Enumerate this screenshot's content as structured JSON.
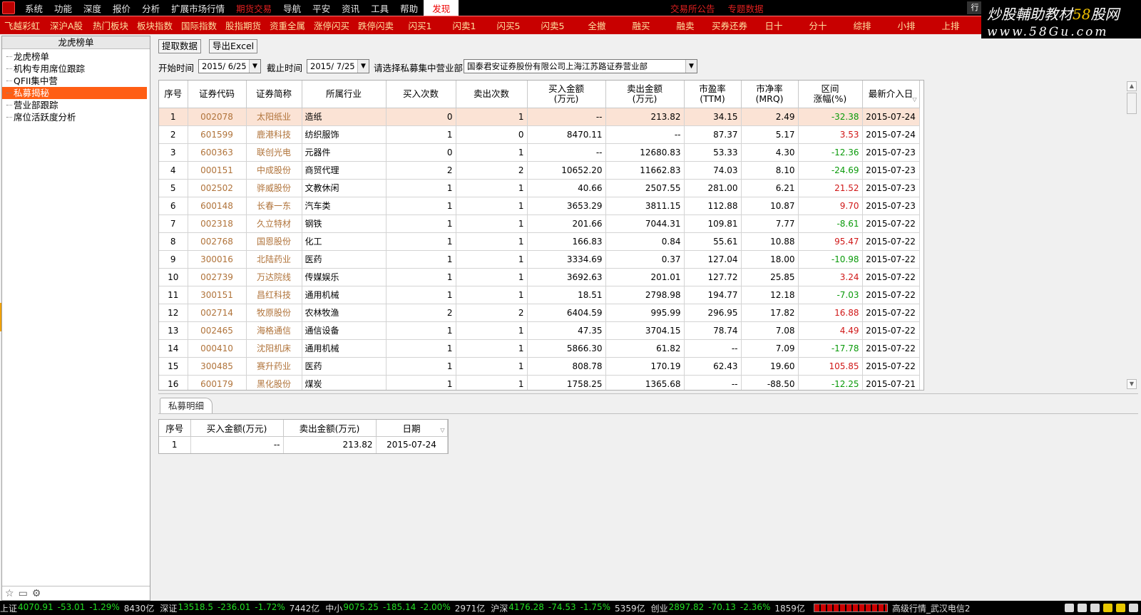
{
  "menu": {
    "items": [
      {
        "label": "系统",
        "style": "normal"
      },
      {
        "label": "功能",
        "style": "normal"
      },
      {
        "label": "深度",
        "style": "normal"
      },
      {
        "label": "报价",
        "style": "normal"
      },
      {
        "label": "分析",
        "style": "normal"
      },
      {
        "label": "扩展市场行情",
        "style": "normal"
      },
      {
        "label": "期货交易",
        "style": "red"
      },
      {
        "label": "导航",
        "style": "normal"
      },
      {
        "label": "平安",
        "style": "normal"
      },
      {
        "label": "资讯",
        "style": "normal"
      },
      {
        "label": "工具",
        "style": "normal"
      },
      {
        "label": "帮助",
        "style": "normal"
      },
      {
        "label": "发现",
        "style": "active"
      }
    ],
    "promo": [
      "交易所公告",
      "专题数据"
    ],
    "right_tab": "行"
  },
  "watermark": {
    "line1_a": "炒股輔助教材",
    "line1_b": "58",
    "line1_c": "股网",
    "line2": "www.58Gu.com"
  },
  "funcbar": [
    "飞越彩虹",
    "深沪A股",
    "热门板块",
    "板块指数",
    "国际指数",
    "股指期货",
    "资重全属",
    "涨停闪买",
    "跌停闪卖",
    "闪买1",
    "闪卖1",
    "闪买5",
    "闪卖5",
    "全撤",
    "融买",
    "融卖",
    "买券还券",
    "日十",
    "分十",
    "综排",
    "小排",
    "上排"
  ],
  "left": {
    "title": "龙虎榜单",
    "items": [
      {
        "label": "龙虎榜单",
        "selected": false
      },
      {
        "label": "机构专用席位跟踪",
        "selected": false
      },
      {
        "label": "QFII集中营",
        "selected": false
      },
      {
        "label": "私募揭秘",
        "selected": true
      },
      {
        "label": "营业部跟踪",
        "selected": false
      },
      {
        "label": "席位活跃度分析",
        "selected": false
      }
    ]
  },
  "toolbar": {
    "fetch_label": "提取数据",
    "export_label": "导出Excel"
  },
  "filter": {
    "start_label": "开始时间",
    "start_value": "2015/ 6/25",
    "end_label": "截止时间",
    "end_value": "2015/ 7/25",
    "dept_label": "请选择私募集中营业部",
    "dept_value": "国泰君安证券股份有限公司上海江苏路证券营业部"
  },
  "table": {
    "headers": [
      "序号",
      "证券代码",
      "证券简称",
      "所属行业",
      "买入次数",
      "卖出次数",
      "买入金额\n(万元)",
      "卖出金额\n(万元)",
      "市盈率\n(TTM)",
      "市净率\n(MRQ)",
      "区间\n涨幅(%)",
      "最新介入日"
    ],
    "rows": [
      {
        "no": "1",
        "code": "002078",
        "name": "太阳纸业",
        "industry": "造纸",
        "buy_n": "0",
        "sell_n": "1",
        "buy_amt": "--",
        "sell_amt": "213.82",
        "pe": "34.15",
        "pb": "2.49",
        "chg": "-32.38",
        "date": "2015-07-24"
      },
      {
        "no": "2",
        "code": "601599",
        "name": "鹿港科技",
        "industry": "纺织服饰",
        "buy_n": "1",
        "sell_n": "0",
        "buy_amt": "8470.11",
        "sell_amt": "--",
        "pe": "87.37",
        "pb": "5.17",
        "chg": "3.53",
        "date": "2015-07-24"
      },
      {
        "no": "3",
        "code": "600363",
        "name": "联创光电",
        "industry": "元器件",
        "buy_n": "0",
        "sell_n": "1",
        "buy_amt": "--",
        "sell_amt": "12680.83",
        "pe": "53.33",
        "pb": "4.30",
        "chg": "-12.36",
        "date": "2015-07-23"
      },
      {
        "no": "4",
        "code": "000151",
        "name": "中成股份",
        "industry": "商贸代理",
        "buy_n": "2",
        "sell_n": "2",
        "buy_amt": "10652.20",
        "sell_amt": "11662.83",
        "pe": "74.03",
        "pb": "8.10",
        "chg": "-24.69",
        "date": "2015-07-23"
      },
      {
        "no": "5",
        "code": "002502",
        "name": "骅威股份",
        "industry": "文教休闲",
        "buy_n": "1",
        "sell_n": "1",
        "buy_amt": "40.66",
        "sell_amt": "2507.55",
        "pe": "281.00",
        "pb": "6.21",
        "chg": "21.52",
        "date": "2015-07-23"
      },
      {
        "no": "6",
        "code": "600148",
        "name": "长春一东",
        "industry": "汽车类",
        "buy_n": "1",
        "sell_n": "1",
        "buy_amt": "3653.29",
        "sell_amt": "3811.15",
        "pe": "112.88",
        "pb": "10.87",
        "chg": "9.70",
        "date": "2015-07-23"
      },
      {
        "no": "7",
        "code": "002318",
        "name": "久立特材",
        "industry": "钢铁",
        "buy_n": "1",
        "sell_n": "1",
        "buy_amt": "201.66",
        "sell_amt": "7044.31",
        "pe": "109.81",
        "pb": "7.77",
        "chg": "-8.61",
        "date": "2015-07-22"
      },
      {
        "no": "8",
        "code": "002768",
        "name": "国恩股份",
        "industry": "化工",
        "buy_n": "1",
        "sell_n": "1",
        "buy_amt": "166.83",
        "sell_amt": "0.84",
        "pe": "55.61",
        "pb": "10.88",
        "chg": "95.47",
        "date": "2015-07-22"
      },
      {
        "no": "9",
        "code": "300016",
        "name": "北陆药业",
        "industry": "医药",
        "buy_n": "1",
        "sell_n": "1",
        "buy_amt": "3334.69",
        "sell_amt": "0.37",
        "pe": "127.04",
        "pb": "18.00",
        "chg": "-10.98",
        "date": "2015-07-22"
      },
      {
        "no": "10",
        "code": "002739",
        "name": "万达院线",
        "industry": "传媒娱乐",
        "buy_n": "1",
        "sell_n": "1",
        "buy_amt": "3692.63",
        "sell_amt": "201.01",
        "pe": "127.72",
        "pb": "25.85",
        "chg": "3.24",
        "date": "2015-07-22"
      },
      {
        "no": "11",
        "code": "300151",
        "name": "昌红科技",
        "industry": "通用机械",
        "buy_n": "1",
        "sell_n": "1",
        "buy_amt": "18.51",
        "sell_amt": "2798.98",
        "pe": "194.77",
        "pb": "12.18",
        "chg": "-7.03",
        "date": "2015-07-22"
      },
      {
        "no": "12",
        "code": "002714",
        "name": "牧原股份",
        "industry": "农林牧渔",
        "buy_n": "2",
        "sell_n": "2",
        "buy_amt": "6404.59",
        "sell_amt": "995.99",
        "pe": "296.95",
        "pb": "17.82",
        "chg": "16.88",
        "date": "2015-07-22"
      },
      {
        "no": "13",
        "code": "002465",
        "name": "海格通信",
        "industry": "通信设备",
        "buy_n": "1",
        "sell_n": "1",
        "buy_amt": "47.35",
        "sell_amt": "3704.15",
        "pe": "78.74",
        "pb": "7.08",
        "chg": "4.49",
        "date": "2015-07-22"
      },
      {
        "no": "14",
        "code": "000410",
        "name": "沈阳机床",
        "industry": "通用机械",
        "buy_n": "1",
        "sell_n": "1",
        "buy_amt": "5866.30",
        "sell_amt": "61.82",
        "pe": "--",
        "pb": "7.09",
        "chg": "-17.78",
        "date": "2015-07-22"
      },
      {
        "no": "15",
        "code": "300485",
        "name": "赛升药业",
        "industry": "医药",
        "buy_n": "1",
        "sell_n": "1",
        "buy_amt": "808.78",
        "sell_amt": "170.19",
        "pe": "62.43",
        "pb": "19.60",
        "chg": "105.85",
        "date": "2015-07-22"
      },
      {
        "no": "16",
        "code": "600179",
        "name": "黑化股份",
        "industry": "煤炭",
        "buy_n": "1",
        "sell_n": "1",
        "buy_amt": "1758.25",
        "sell_amt": "1365.68",
        "pe": "--",
        "pb": "-88.50",
        "chg": "-12.25",
        "date": "2015-07-21"
      }
    ]
  },
  "detail": {
    "tab_label": "私募明细",
    "headers": [
      "序号",
      "买入金额(万元)",
      "卖出金额(万元)",
      "日期"
    ],
    "rows": [
      {
        "no": "1",
        "buy_amt": "--",
        "sell_amt": "213.82",
        "date": "2015-07-24"
      }
    ]
  },
  "status": {
    "indices": [
      {
        "name": "上证",
        "value": "4070.91",
        "chg": "-53.01",
        "pct": "-1.29%",
        "amt": "8430亿"
      },
      {
        "name": "深证",
        "value": "13518.5",
        "chg": "-236.01",
        "pct": "-1.72%",
        "amt": "7442亿"
      },
      {
        "name": "中小",
        "value": "9075.25",
        "chg": "-185.14",
        "pct": "-2.00%",
        "amt": "2971亿"
      },
      {
        "name": "沪深",
        "value": "4176.28",
        "chg": "-74.53",
        "pct": "-1.75%",
        "amt": "5359亿"
      },
      {
        "name": "创业",
        "value": "2897.82",
        "chg": "-70.13",
        "pct": "-2.36%",
        "amt": "1859亿"
      }
    ],
    "server": "高级行情_武汉电信2"
  },
  "colors": {
    "accent_red": "#c80000",
    "selection_orange": "#ff5e14",
    "up": "#d01818",
    "down": "#0a9a0a",
    "code_brown": "#b0733a"
  },
  "icons": {
    "favorite": "star-icon",
    "folder": "folder-icon",
    "settings": "gear-icon"
  }
}
